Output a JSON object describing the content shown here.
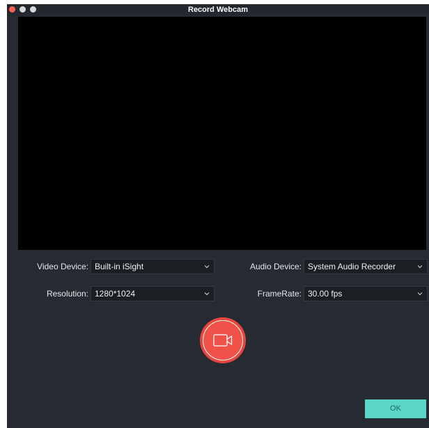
{
  "window": {
    "title": "Record Webcam"
  },
  "video_device": {
    "label": "Video Device:",
    "value": "Built-in iSight"
  },
  "audio_device": {
    "label": "Audio Device:",
    "value": "System Audio Recorder"
  },
  "resolution": {
    "label": "Resolution:",
    "value": "1280*1024"
  },
  "framerate": {
    "label": "FrameRate:",
    "value": "30.00 fps"
  },
  "record_button": {
    "icon": "video-camera-icon",
    "color": "#f0524a"
  },
  "ok_button": {
    "label": "OK",
    "color": "#5ad6c7"
  },
  "colors": {
    "background": "#262b33",
    "preview": "#000000",
    "close_dot": "#fe5f57"
  }
}
